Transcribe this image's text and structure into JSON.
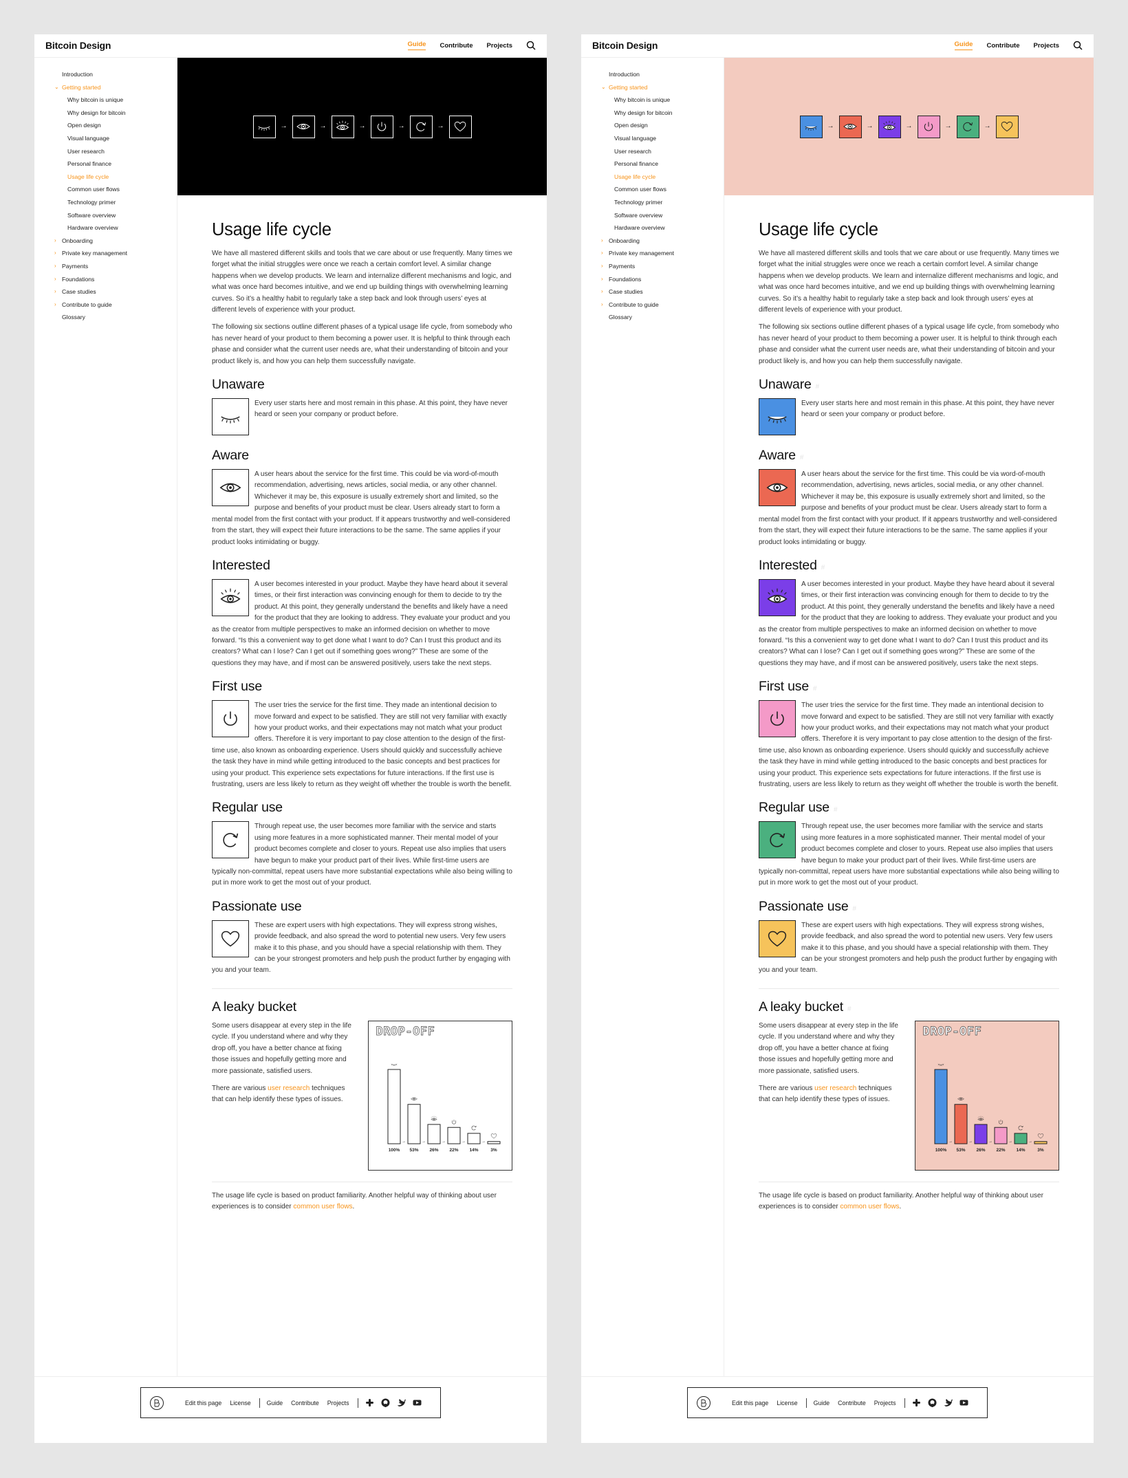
{
  "site": {
    "logo": "Bitcoin Design"
  },
  "nav": {
    "guide": "Guide",
    "contribute": "Contribute",
    "projects": "Projects",
    "search_icon": "search-icon"
  },
  "sidebar": {
    "items": [
      {
        "label": "Introduction",
        "level": 0,
        "state": "none"
      },
      {
        "label": "Getting started",
        "level": 0,
        "state": "open",
        "active": true
      },
      {
        "label": "Why bitcoin is unique",
        "level": 1
      },
      {
        "label": "Why design for bitcoin",
        "level": 1
      },
      {
        "label": "Open design",
        "level": 1
      },
      {
        "label": "Visual language",
        "level": 1
      },
      {
        "label": "User research",
        "level": 1
      },
      {
        "label": "Personal finance",
        "level": 1
      },
      {
        "label": "Usage life cycle",
        "level": 1,
        "active": true
      },
      {
        "label": "Common user flows",
        "level": 1
      },
      {
        "label": "Technology primer",
        "level": 1
      },
      {
        "label": "Software overview",
        "level": 1
      },
      {
        "label": "Hardware overview",
        "level": 1
      },
      {
        "label": "Onboarding",
        "level": 0,
        "state": "closed"
      },
      {
        "label": "Private key management",
        "level": 0,
        "state": "closed"
      },
      {
        "label": "Payments",
        "level": 0,
        "state": "closed"
      },
      {
        "label": "Foundations",
        "level": 0,
        "state": "closed"
      },
      {
        "label": "Case studies",
        "level": 0,
        "state": "closed"
      },
      {
        "label": "Contribute to guide",
        "level": 0,
        "state": "closed"
      },
      {
        "label": "Glossary",
        "level": 0,
        "state": "none"
      }
    ]
  },
  "hero": {
    "icons": [
      "closed-eye-icon",
      "eye-icon",
      "interested-eye-icon",
      "power-icon",
      "refresh-icon",
      "heart-icon"
    ],
    "arrow": "→"
  },
  "content": {
    "title": "Usage life cycle",
    "intro1": "We have all mastered different skills and tools that we care about or use frequently. Many times we forget what the initial struggles were once we reach a certain comfort level. A similar change happens when we develop products. We learn and internalize different mechanisms and logic, and what was once hard becomes intuitive, and we end up building things with overwhelming learning curves. So it’s a healthy habit to regularly take a step back and look through users’ eyes at different levels of experience with your product.",
    "intro2": "The following six sections outline different phases of a typical usage life cycle, from somebody who has never heard of your product to them becoming a power user. It is helpful to think through each phase and consider what the current user needs are, what their understanding of bitcoin and your product likely is, and how you can help them successfully navigate.",
    "anchor": "#",
    "phases": [
      {
        "title": "Unaware",
        "icon": "closed-eye-icon",
        "text": "Every user starts here and most remain in this phase. At this point, they have never heard or seen your company or product before."
      },
      {
        "title": "Aware",
        "icon": "eye-icon",
        "text": "A user hears about the service for the first time. This could be via word-of-mouth recommendation, advertising, news articles, social media, or any other channel. Whichever it may be, this exposure is usually extremely short and limited, so the purpose and benefits of your product must be clear. Users already start to form a mental model from the first contact with your product. If it appears trustworthy and well-considered from the start, they will expect their future interactions to be the same. The same applies if your product looks intimidating or buggy."
      },
      {
        "title": "Interested",
        "icon": "interested-eye-icon",
        "text": "A user becomes interested in your product. Maybe they have heard about it several times, or their first interaction was convincing enough for them to decide to try the product. At this point, they generally understand the benefits and likely have a need for the product that they are looking to address. They evaluate your product and you as the creator from multiple perspectives to make an informed decision on whether to move forward. “Is this a convenient way to get done what I want to do? Can I trust this product and its creators? What can I lose? Can I get out if something goes wrong?” These are some of the questions they may have, and if most can be answered positively, users take the next steps."
      },
      {
        "title": "First use",
        "icon": "power-icon",
        "text": "The user tries the service for the first time. They made an intentional decision to move forward and expect to be satisfied. They are still not very familiar with exactly how your product works, and their expectations may not match what your product offers. Therefore it is very important to pay close attention to the design of the first-time use, also known as onboarding experience. Users should quickly and successfully achieve the task they have in mind while getting introduced to the basic concepts and best practices for using your product. This experience sets expectations for future interactions. If the first use is frustrating, users are less likely to return as they weight off whether the trouble is worth the benefit."
      },
      {
        "title": "Regular use",
        "icon": "refresh-icon",
        "text": "Through repeat use, the user becomes more familiar with the service and starts using more features in a more sophisticated manner. Their mental model of your product becomes complete and closer to yours. Repeat use also implies that users have begun to make your product part of their lives. While first-time users are typically non-committal, repeat users have more substantial expectations while also being willing to put in more work to get the most out of your product."
      },
      {
        "title": "Passionate use",
        "icon": "heart-icon",
        "text": "These are expert users with high expectations. They will express strong wishes, provide feedback, and also spread the word to potential new users. Very few users make it to this phase, and you should have a special relationship with them. They can be your strongest promoters and help push the product further by engaging with you and your team."
      }
    ],
    "leaky": {
      "title": "A leaky bucket",
      "p1": "Some users disappear at every step in the life cycle. If you understand where and why they drop off, you have a better chance at fixing those issues and hopefully getting more and more passionate, satisfied users.",
      "p2_before": "There are various ",
      "p2_link": "user research",
      "p2_after": " techniques that can help identify these types of issues."
    },
    "closing_before": "The usage life cycle is based on product familiarity. Another helpful way of thinking about user experiences is to consider ",
    "closing_link": "common user flows",
    "closing_after": "."
  },
  "chart_data": {
    "type": "bar",
    "title": "DROP-OFF",
    "categories": [
      "Unaware",
      "Aware",
      "Interested",
      "First use",
      "Regular use",
      "Passionate use"
    ],
    "values": [
      100,
      53,
      26,
      22,
      14,
      3
    ],
    "labels": [
      "100%",
      "53%",
      "26%",
      "22%",
      "14%",
      "3%"
    ],
    "ylim": [
      0,
      100
    ]
  },
  "footer": {
    "edit": "Edit this page",
    "license": "License",
    "guide": "Guide",
    "contribute": "Contribute",
    "projects": "Projects",
    "icons": [
      "slack-icon",
      "github-icon",
      "twitter-icon",
      "youtube-icon"
    ]
  },
  "themes": {
    "left": {
      "hero_bg": "#000000",
      "hero_stroke": "#ffffff",
      "icon_fills": [
        "#ffffff",
        "#ffffff",
        "#ffffff",
        "#ffffff",
        "#ffffff",
        "#ffffff"
      ],
      "chart_bg": "#ffffff"
    },
    "right": {
      "hero_bg": "#f3cbbf",
      "hero_stroke": "#222222",
      "icon_fills": [
        "#4a90e2",
        "#eb6852",
        "#7b3ee8",
        "#f49ac8",
        "#4bb07f",
        "#f6c35b"
      ],
      "chart_bg": "#f3cbbf"
    },
    "accent": "#f7931a"
  }
}
